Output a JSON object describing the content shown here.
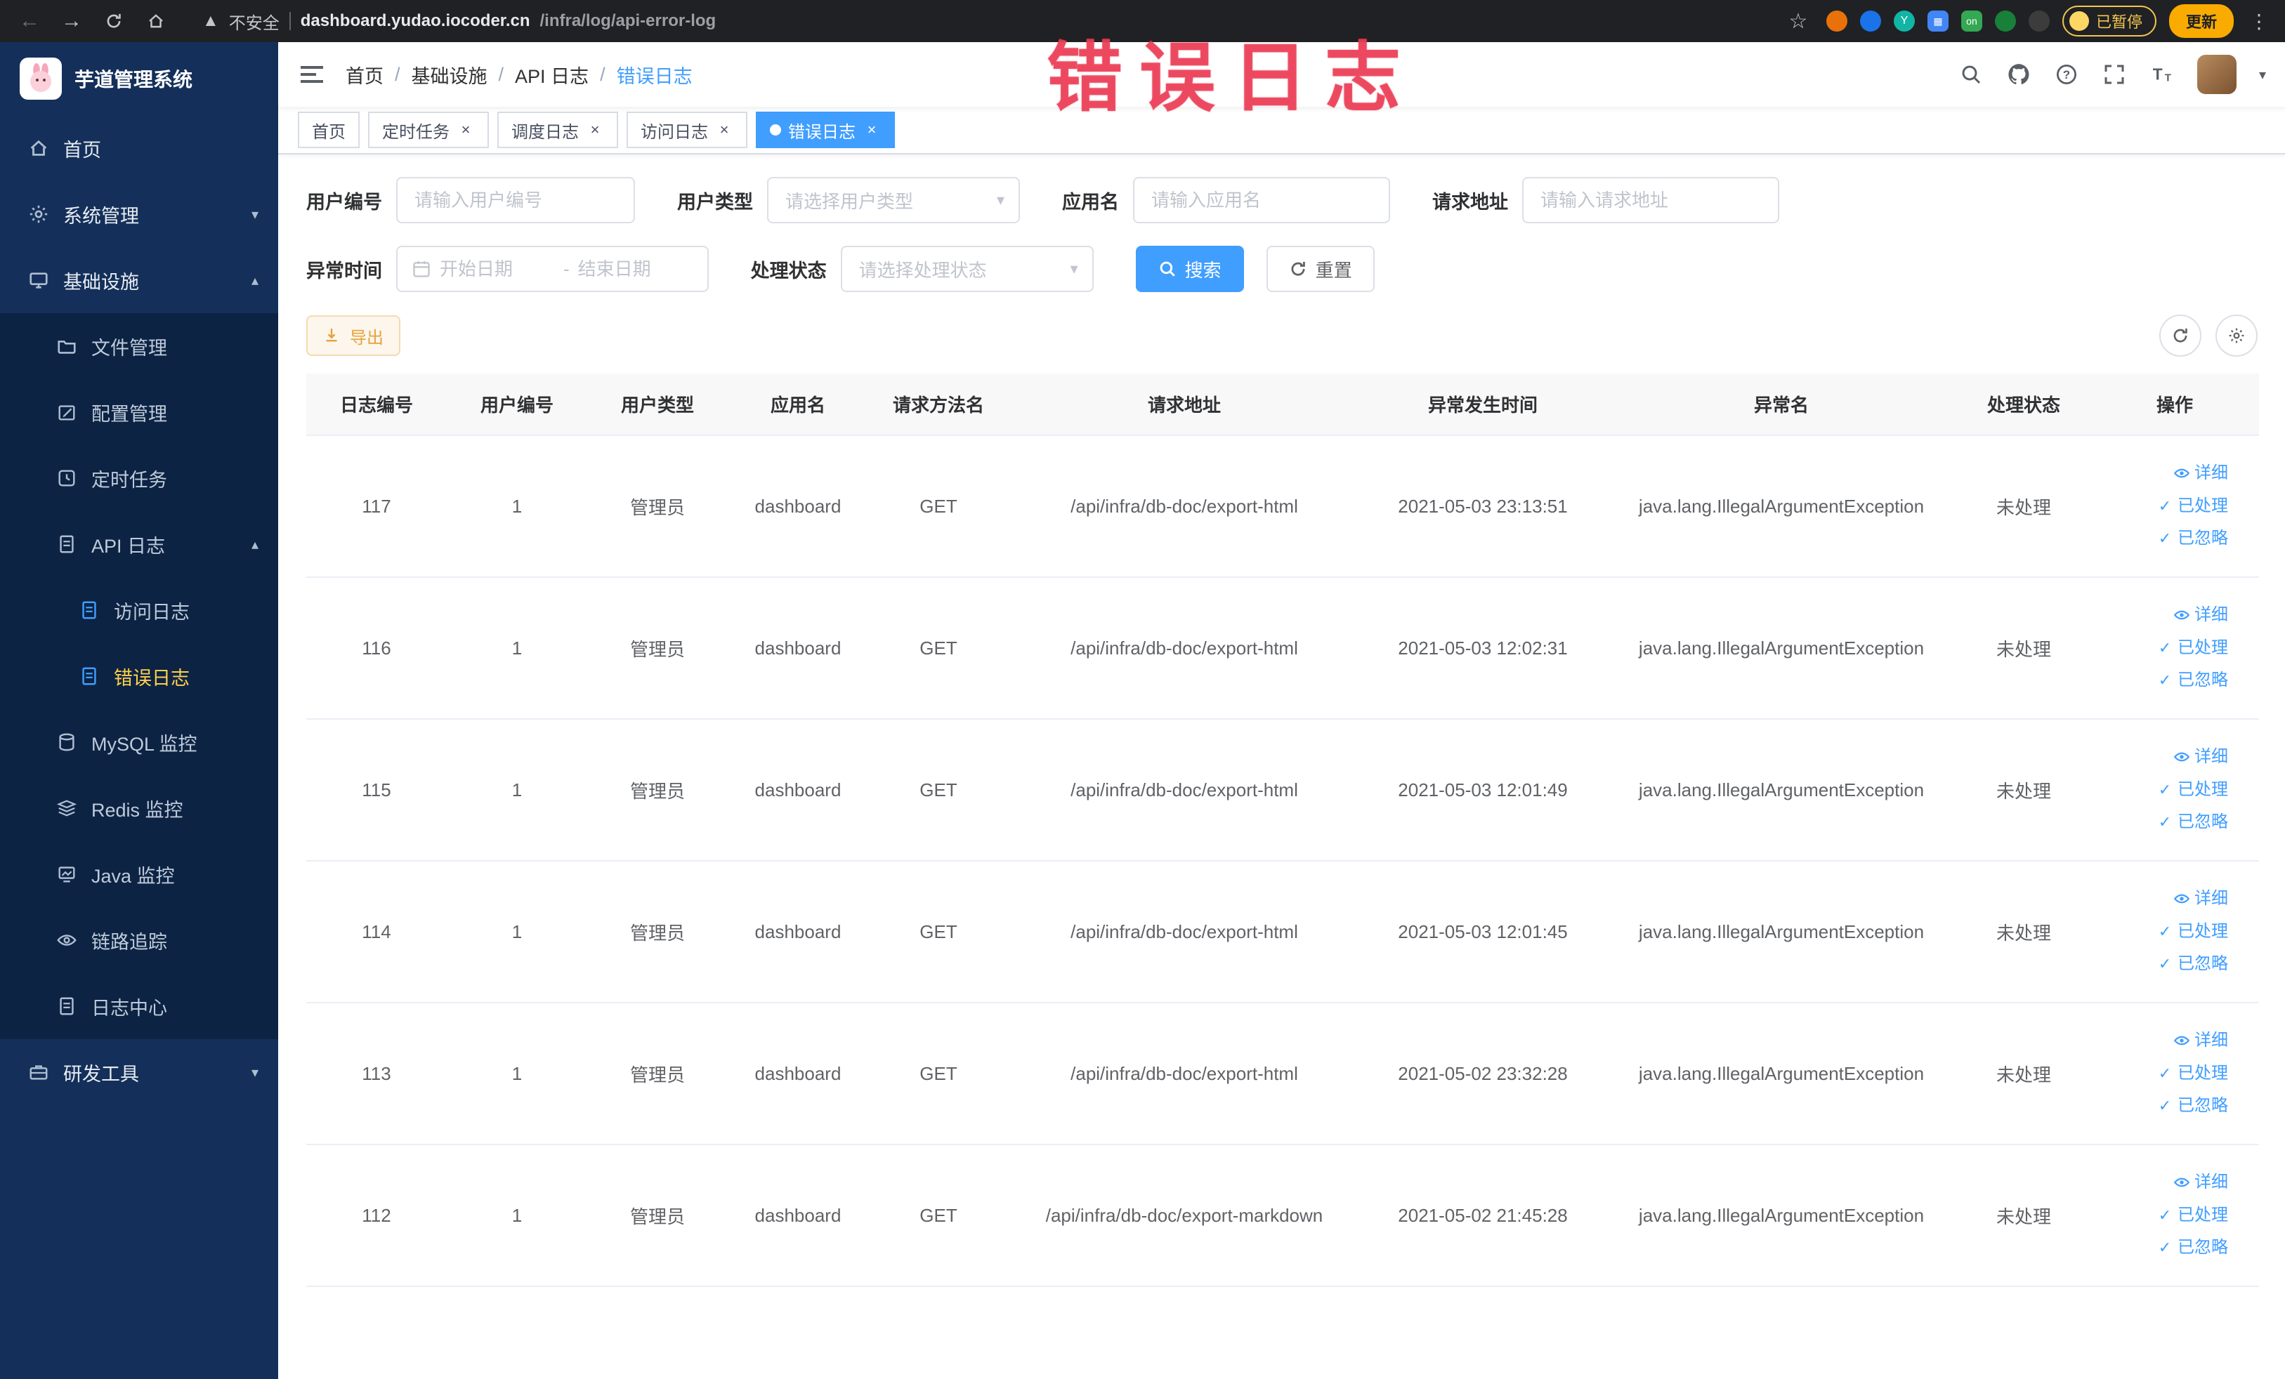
{
  "browser": {
    "security_label": "不安全",
    "url_host": "dashboard.yudao.iocoder.cn",
    "url_path": "/infra/log/api-error-log",
    "ext5_label": "on",
    "paused_label": "已暂停",
    "update_label": "更新"
  },
  "sidebar": {
    "app_title": "芋道管理系统",
    "items": [
      {
        "label": "首页"
      },
      {
        "label": "系统管理"
      },
      {
        "label": "基础设施"
      },
      {
        "label": "文件管理"
      },
      {
        "label": "配置管理"
      },
      {
        "label": "定时任务"
      },
      {
        "label": "API 日志"
      },
      {
        "label": "访问日志"
      },
      {
        "label": "错误日志"
      },
      {
        "label": "MySQL 监控"
      },
      {
        "label": "Redis 监控"
      },
      {
        "label": "Java 监控"
      },
      {
        "label": "链路追踪"
      },
      {
        "label": "日志中心"
      },
      {
        "label": "研发工具"
      }
    ]
  },
  "breadcrumb": [
    "首页",
    "基础设施",
    "API 日志",
    "错误日志"
  ],
  "tags": [
    {
      "label": "首页"
    },
    {
      "label": "定时任务"
    },
    {
      "label": "调度日志"
    },
    {
      "label": "访问日志"
    },
    {
      "label": "错误日志"
    }
  ],
  "annotation": {
    "text": "错误日志",
    "color": "#eb3e55"
  },
  "filters": {
    "user_id_label": "用户编号",
    "user_id_placeholder": "请输入用户编号",
    "user_type_label": "用户类型",
    "user_type_placeholder": "请选择用户类型",
    "app_name_label": "应用名",
    "app_name_placeholder": "请输入应用名",
    "request_url_label": "请求地址",
    "request_url_placeholder": "请输入请求地址",
    "exception_time_label": "异常时间",
    "start_date_placeholder": "开始日期",
    "range_separator": "-",
    "end_date_placeholder": "结束日期",
    "status_label": "处理状态",
    "status_placeholder": "请选择处理状态",
    "search_button": "搜索",
    "reset_button": "重置"
  },
  "toolbar": {
    "export_button": "导出"
  },
  "table": {
    "columns": [
      "日志编号",
      "用户编号",
      "用户类型",
      "应用名",
      "请求方法名",
      "请求地址",
      "异常发生时间",
      "异常名",
      "处理状态",
      "操作"
    ],
    "actions": [
      "详细",
      "已处理",
      "已忽略"
    ],
    "rows": [
      {
        "id": "117",
        "user_id": "1",
        "user_type": "管理员",
        "app": "dashboard",
        "method": "GET",
        "url": "/api/infra/db-doc/export-html",
        "time": "2021-05-03 23:13:51",
        "exception": "java.lang.IllegalArgumentException",
        "status": "未处理"
      },
      {
        "id": "116",
        "user_id": "1",
        "user_type": "管理员",
        "app": "dashboard",
        "method": "GET",
        "url": "/api/infra/db-doc/export-html",
        "time": "2021-05-03 12:02:31",
        "exception": "java.lang.IllegalArgumentException",
        "status": "未处理"
      },
      {
        "id": "115",
        "user_id": "1",
        "user_type": "管理员",
        "app": "dashboard",
        "method": "GET",
        "url": "/api/infra/db-doc/export-html",
        "time": "2021-05-03 12:01:49",
        "exception": "java.lang.IllegalArgumentException",
        "status": "未处理"
      },
      {
        "id": "114",
        "user_id": "1",
        "user_type": "管理员",
        "app": "dashboard",
        "method": "GET",
        "url": "/api/infra/db-doc/export-html",
        "time": "2021-05-03 12:01:45",
        "exception": "java.lang.IllegalArgumentException",
        "status": "未处理"
      },
      {
        "id": "113",
        "user_id": "1",
        "user_type": "管理员",
        "app": "dashboard",
        "method": "GET",
        "url": "/api/infra/db-doc/export-html",
        "time": "2021-05-02 23:32:28",
        "exception": "java.lang.IllegalArgumentException",
        "status": "未处理"
      },
      {
        "id": "112",
        "user_id": "1",
        "user_type": "管理员",
        "app": "dashboard",
        "method": "GET",
        "url": "/api/infra/db-doc/export-markdown",
        "time": "2021-05-02 21:45:28",
        "exception": "java.lang.IllegalArgumentException",
        "status": "未处理"
      }
    ]
  }
}
